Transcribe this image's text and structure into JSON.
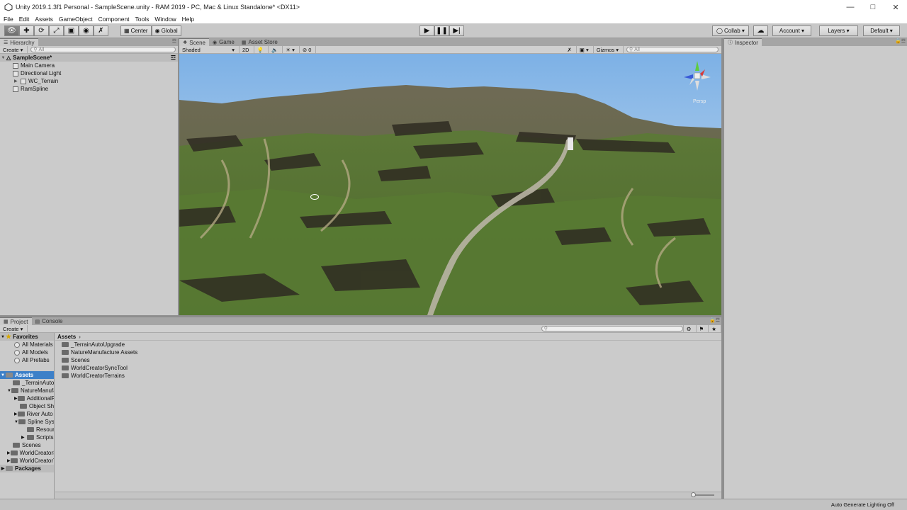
{
  "window": {
    "title": "Unity 2019.1.3f1 Personal - SampleScene.unity - RAM 2019 - PC, Mac & Linux Standalone* <DX11>"
  },
  "menu": [
    "File",
    "Edit",
    "Assets",
    "GameObject",
    "Component",
    "Tools",
    "Window",
    "Help"
  ],
  "toolbar": {
    "center": "Center",
    "global": "Global",
    "collab": "Collab",
    "account": "Account",
    "layers": "Layers",
    "layout": "Default"
  },
  "hierarchy": {
    "tab": "Hierarchy",
    "create": "Create",
    "search_placeholder": "All",
    "scene": "SampleScene*",
    "items": [
      "Main Camera",
      "Directional Light",
      "WC_Terrain",
      "RamSpline"
    ]
  },
  "scene": {
    "tabs": [
      "Scene",
      "Game",
      "Asset Store"
    ],
    "shading": "Shaded",
    "mode2d": "2D",
    "gizmo_count": "0",
    "gizmos": "Gizmos",
    "search_placeholder": "All",
    "persp": "Persp"
  },
  "inspector": {
    "tab": "Inspector"
  },
  "project": {
    "tabs": [
      "Project",
      "Console"
    ],
    "create": "Create",
    "favorites": {
      "label": "Favorites",
      "items": [
        "All Materials",
        "All Models",
        "All Prefabs"
      ]
    },
    "tree": {
      "assets": "Assets",
      "items": [
        {
          "label": "_TerrainAutoUpgrade",
          "depth": 1
        },
        {
          "label": "NatureManufacture Assets",
          "depth": 1
        },
        {
          "label": "AdditionalResources",
          "depth": 2
        },
        {
          "label": "Object Shaders",
          "depth": 2
        },
        {
          "label": "River Auto Material",
          "depth": 2
        },
        {
          "label": "Spline System",
          "depth": 2
        },
        {
          "label": "Resources",
          "depth": 3
        },
        {
          "label": "Scripts",
          "depth": 3
        },
        {
          "label": "Scenes",
          "depth": 1
        },
        {
          "label": "WorldCreatorSyncTool",
          "depth": 1
        },
        {
          "label": "WorldCreatorTerrains",
          "depth": 1
        }
      ],
      "packages": "Packages"
    },
    "breadcrumb": "Assets",
    "folders": [
      "_TerrainAutoUpgrade",
      "NatureManufacture Assets",
      "Scenes",
      "WorldCreatorSyncTool",
      "WorldCreatorTerrains"
    ]
  },
  "status": {
    "lighting": "Auto Generate Lighting Off"
  }
}
